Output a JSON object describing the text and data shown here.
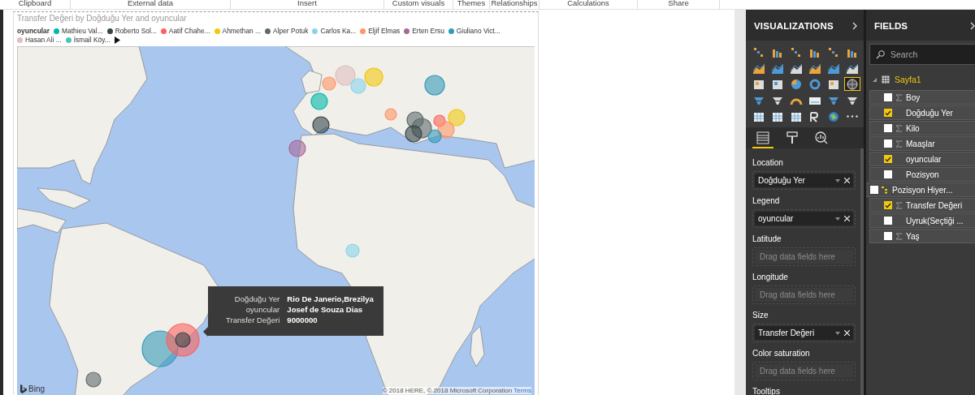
{
  "ribbon_groups": [
    "Clipboard",
    "External data",
    "Insert",
    "Custom visuals",
    "Themes",
    "Relationships",
    "Calculations",
    "Share"
  ],
  "visual": {
    "title": "Transfer Değeri by Doğduğu Yer and oyuncular",
    "legend": {
      "label": "oyuncular",
      "items": [
        {
          "name": "Mathieu Val...",
          "color": "#01b8aa"
        },
        {
          "name": "Roberto Sol...",
          "color": "#374649"
        },
        {
          "name": "Aatif Chahe...",
          "color": "#fd625e"
        },
        {
          "name": "Ahmethan ...",
          "color": "#f2c80f"
        },
        {
          "name": "Alper Potuk",
          "color": "#5f6b6d"
        },
        {
          "name": "Carlos Ka...",
          "color": "#8ad4eb"
        },
        {
          "name": "Eljif Elmas",
          "color": "#fe9666"
        },
        {
          "name": "Erten Ersu",
          "color": "#a66999"
        },
        {
          "name": "Giuliano Vict...",
          "color": "#3599b8"
        },
        {
          "name": "Hasan Ali ...",
          "color": "#dfbfbf"
        },
        {
          "name": "İsmail Köy...",
          "color": "#4ac5bb"
        }
      ]
    },
    "tooltip": [
      {
        "label": "Doğduğu Yer",
        "value": "Rio De Janerio,Brezilya"
      },
      {
        "label": "oyuncular",
        "value": "Josef de Souza Dias"
      },
      {
        "label": "Transfer Değeri",
        "value": "9000000"
      }
    ],
    "attribution": {
      "logo": "Bing",
      "copyright": "© 2018 HERE, © 2018 Microsoft Corporation",
      "link": "Terms"
    }
  },
  "visualizations": {
    "title": "VISUALIZATIONS",
    "visual_types": [
      {
        "selected": false
      },
      {
        "selected": false
      },
      {
        "selected": false
      },
      {
        "selected": false
      },
      {
        "selected": false
      },
      {
        "selected": false
      },
      {
        "selected": false
      },
      {
        "selected": false
      },
      {
        "selected": false
      },
      {
        "selected": false
      },
      {
        "selected": false
      },
      {
        "selected": false
      },
      {
        "selected": false
      },
      {
        "selected": false
      },
      {
        "selected": false
      },
      {
        "selected": false
      },
      {
        "selected": false
      },
      {
        "selected": true
      },
      {
        "selected": false
      },
      {
        "selected": false
      },
      {
        "selected": false
      },
      {
        "selected": false
      },
      {
        "selected": false
      },
      {
        "selected": false
      },
      {
        "selected": false
      },
      {
        "selected": false
      },
      {
        "selected": false
      },
      {
        "selected": false
      },
      {
        "selected": false
      },
      {
        "selected": false
      }
    ],
    "tabs": [
      {
        "kind": "fields",
        "selected": true
      },
      {
        "kind": "format",
        "selected": false
      },
      {
        "kind": "analytics",
        "selected": false
      }
    ],
    "wells": [
      {
        "label": "Location",
        "value": "Doğduğu Yer"
      },
      {
        "label": "Legend",
        "value": "oyuncular"
      },
      {
        "label": "Latitude",
        "placeholder": "Drag data fields here"
      },
      {
        "label": "Longitude",
        "placeholder": "Drag data fields here"
      },
      {
        "label": "Size",
        "value": "Transfer Değeri"
      },
      {
        "label": "Color saturation",
        "placeholder": "Drag data fields here"
      },
      {
        "label": "Tooltips"
      }
    ]
  },
  "fields": {
    "title": "FIELDS",
    "search": {
      "placeholder": "Search"
    },
    "table": {
      "name": "Sayfa1",
      "expanded": true,
      "fields": [
        {
          "name": "Boy",
          "kind": "measure",
          "checked": false
        },
        {
          "name": "Doğduğu Yer",
          "kind": "text",
          "checked": true
        },
        {
          "name": "Kilo",
          "kind": "measure",
          "checked": false
        },
        {
          "name": "Maaşlar",
          "kind": "measure",
          "checked": false
        },
        {
          "name": "oyuncular",
          "kind": "text",
          "checked": true
        },
        {
          "name": "Pozisyon",
          "kind": "text",
          "checked": false
        },
        {
          "name": "Pozisyon Hiyer...",
          "kind": "hierarchy",
          "checked": false
        },
        {
          "name": "Transfer Değeri",
          "kind": "measure",
          "checked": true
        },
        {
          "name": "Uyruk(Seçtiği ...",
          "kind": "text",
          "checked": false
        },
        {
          "name": "Yaş",
          "kind": "measure",
          "checked": false
        }
      ]
    }
  }
}
